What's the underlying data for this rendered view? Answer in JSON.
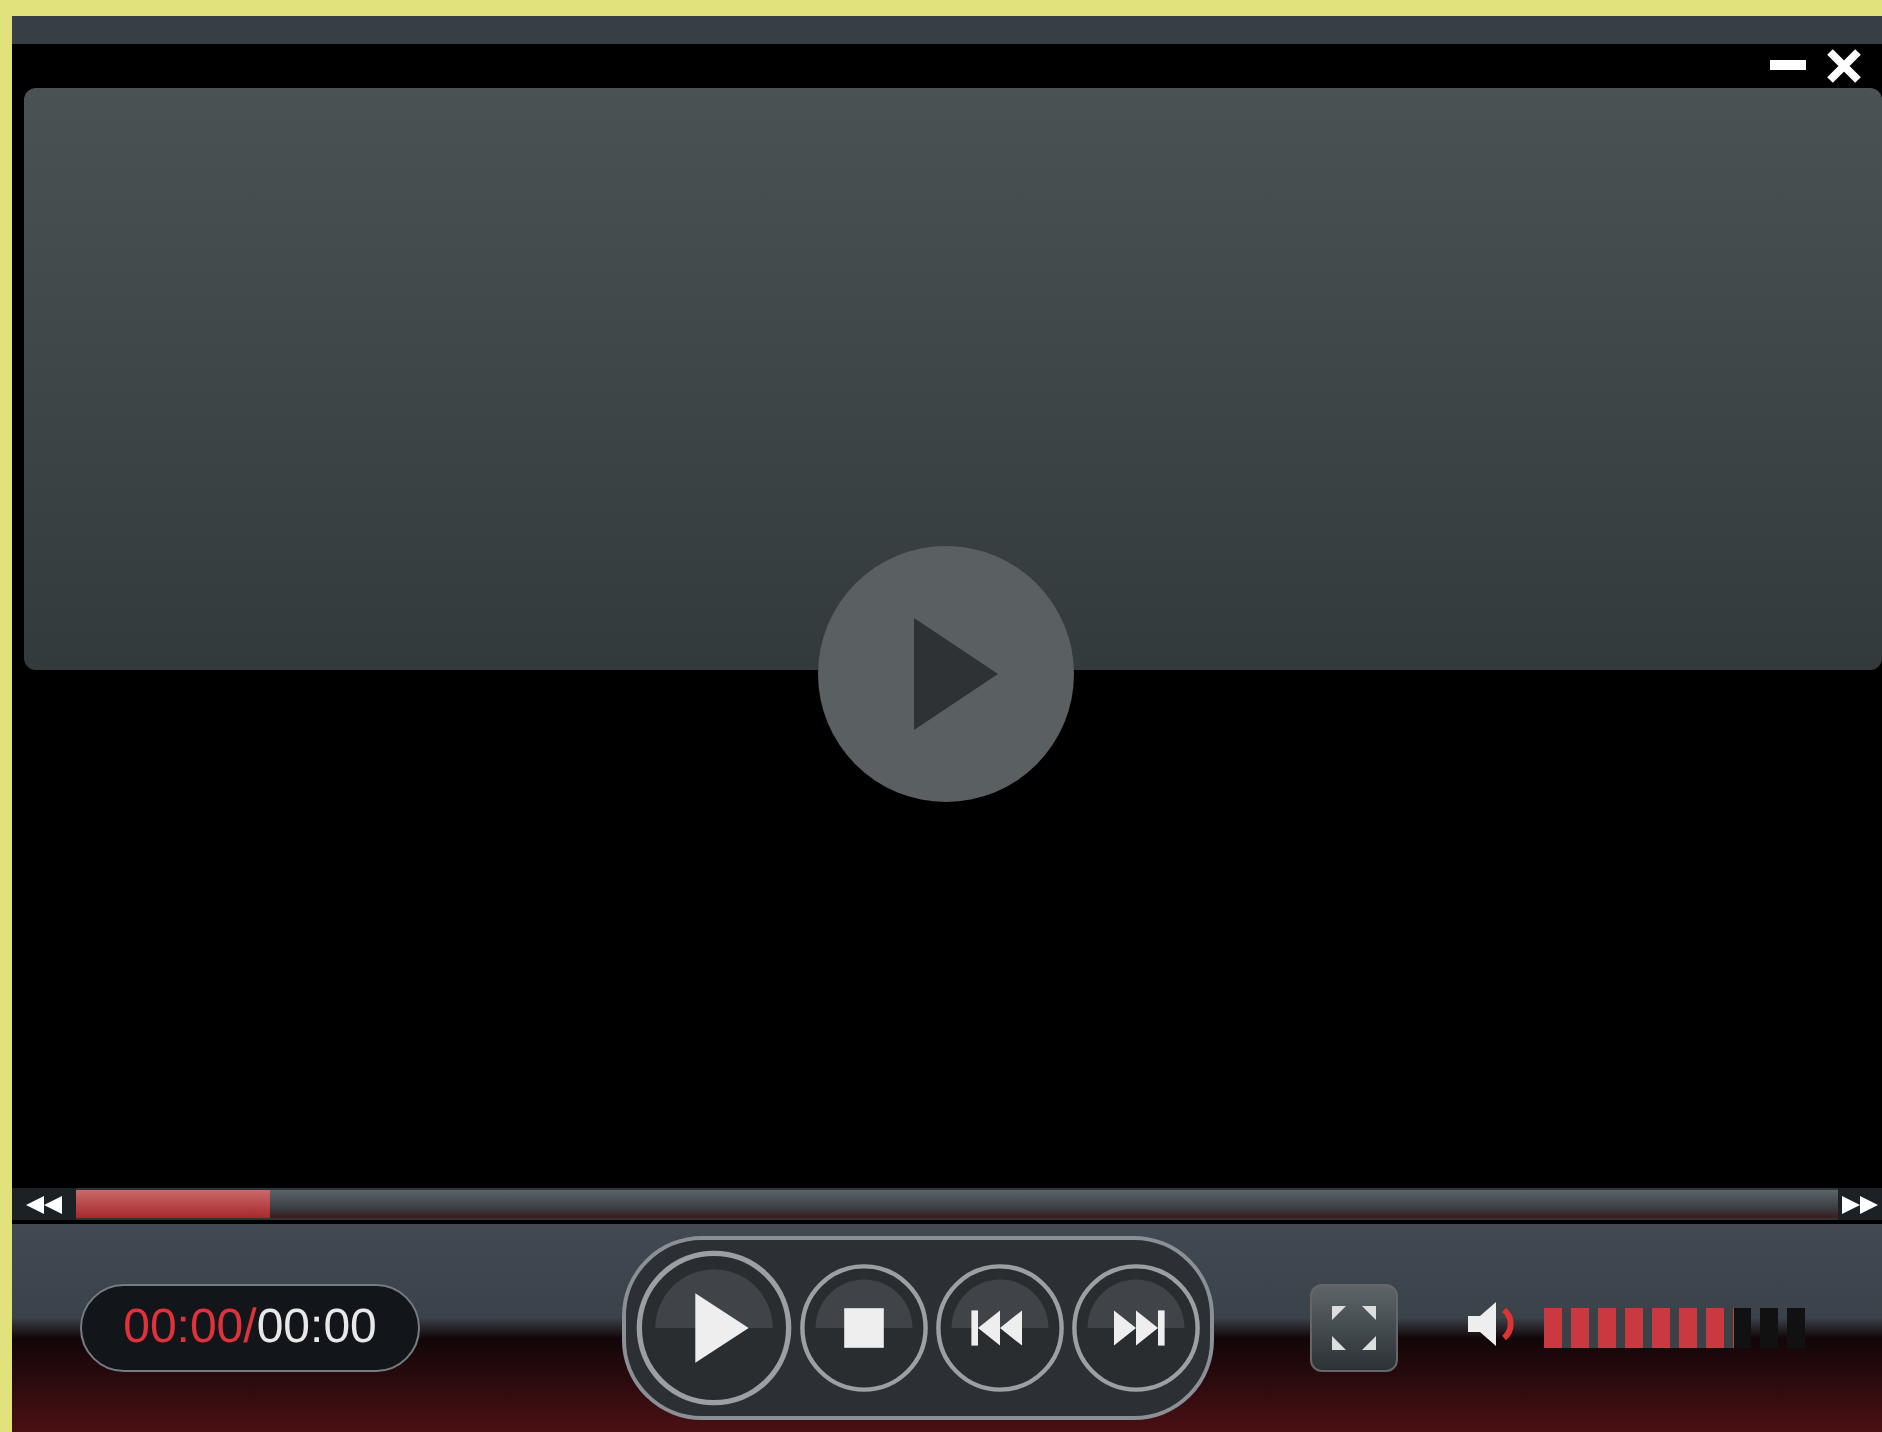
{
  "player": {
    "time": {
      "elapsed": "00:00/",
      "total": "00:00"
    },
    "seek": {
      "level": 0.11
    },
    "volume": {
      "level": 0.7
    }
  }
}
